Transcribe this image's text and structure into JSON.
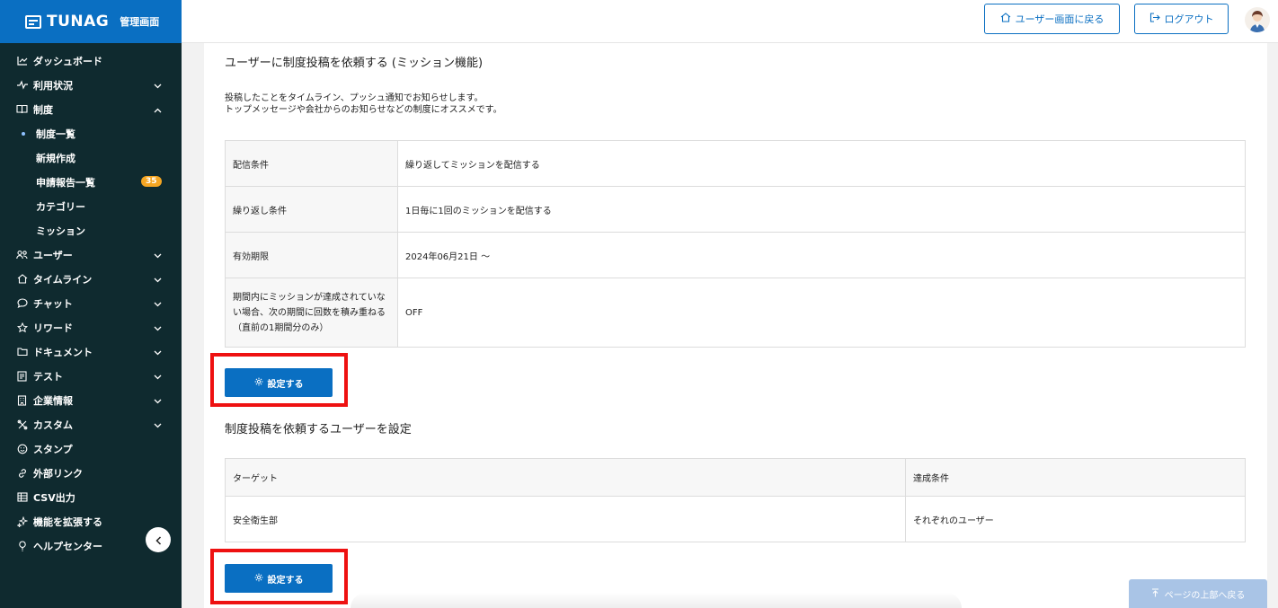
{
  "brand": {
    "name": "TUNAG",
    "sub": "管理画面"
  },
  "sidebar": {
    "items": [
      {
        "label": "ダッシュボード",
        "icon": "chart-line-icon"
      },
      {
        "label": "利用状況",
        "icon": "pulse-icon",
        "expandable": true
      },
      {
        "label": "制度",
        "icon": "book-icon",
        "expanded": true
      },
      {
        "label": "ユーザー",
        "icon": "users-icon",
        "expandable": true
      },
      {
        "label": "タイムライン",
        "icon": "home-icon",
        "expandable": true
      },
      {
        "label": "チャット",
        "icon": "chat-icon",
        "expandable": true
      },
      {
        "label": "リワード",
        "icon": "star-icon",
        "expandable": true
      },
      {
        "label": "ドキュメント",
        "icon": "folder-icon",
        "expandable": true
      },
      {
        "label": "テスト",
        "icon": "test-icon",
        "expandable": true
      },
      {
        "label": "企業情報",
        "icon": "building-icon",
        "expandable": true
      },
      {
        "label": "カスタム",
        "icon": "custom-icon",
        "expandable": true
      },
      {
        "label": "スタンプ",
        "icon": "smile-icon"
      },
      {
        "label": "外部リンク",
        "icon": "link-icon"
      },
      {
        "label": "CSV出力",
        "icon": "table-icon"
      },
      {
        "label": "機能を拡張する",
        "icon": "sparkle-icon"
      },
      {
        "label": "ヘルプセンター",
        "icon": "help-icon"
      }
    ],
    "sub_items": [
      {
        "label": "制度一覧",
        "active": true
      },
      {
        "label": "新規作成"
      },
      {
        "label": "申請報告一覧",
        "badge": "35"
      },
      {
        "label": "カテゴリー"
      },
      {
        "label": "ミッション"
      }
    ]
  },
  "header": {
    "back_label": "ユーザー画面に戻る",
    "logout_label": "ログアウト"
  },
  "main": {
    "section1_title": "ユーザーに制度投稿を依頼する (ミッション機能)",
    "desc_line1": "投稿したことをタイムライン、プッシュ通知でお知らせします。",
    "desc_line2": "トップメッセージや会社からのお知らせなどの制度にオススメです。",
    "settings_table": [
      {
        "key": "配信条件",
        "value": "繰り返してミッションを配信する"
      },
      {
        "key": "繰り返し条件",
        "value": "1日毎に1回のミッションを配信する"
      },
      {
        "key": "有効期限",
        "value": "2024年06月21日 〜"
      },
      {
        "key": "期間内にミッションが達成されていない場合、次の期間に回数を積み重ねる（直前の1期間分のみ）",
        "value": "OFF"
      }
    ],
    "settings_button": "設定する",
    "section2_title": "制度投稿を依頼するユーザーを設定",
    "target_table": {
      "headers": [
        "ターゲット",
        "達成条件"
      ],
      "rows": [
        [
          "安全衛生部",
          "それぞれのユーザー"
        ]
      ]
    },
    "settings_button2": "設定する",
    "back_to_top": "ページの上部へ戻る"
  },
  "colors": {
    "brand": "#0a6fc2",
    "sidebar": "#0f2a2f",
    "highlight": "#ee1111",
    "badge": "#f5a623"
  }
}
